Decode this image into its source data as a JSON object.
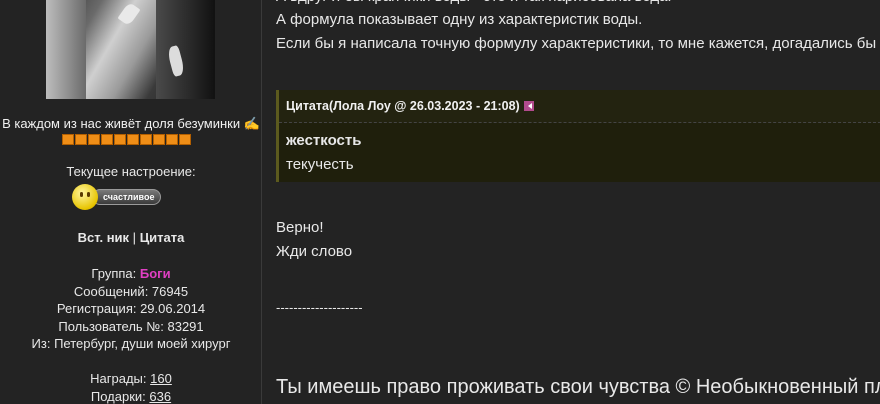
{
  "sidebar": {
    "motto": "В каждом из нас живёт доля безуминки ✍",
    "rank_bar": {
      "filled": 10,
      "total": 10,
      "color": "#ef8e17"
    },
    "mood_label": "Текущее настроение:",
    "mood_value": "счастливое",
    "insert_nick": "Вст. ник",
    "separator": "|",
    "quote": "Цитата",
    "group_label": "Группа:",
    "group_value": "Боги",
    "group_color": "#e03fc3",
    "messages": "Сообщений: 76945",
    "registration": "Регистрация: 29.06.2014",
    "user_number": "Пользователь №: 83291",
    "location": "Из: Петербург, души моей хирург",
    "awards_label": "Награды:",
    "awards_value": "160",
    "gifts_label": "Подарки:",
    "gifts_value": "636"
  },
  "post": {
    "cut_line": "А вдруг я бы кранчики воды - это и так нарисована вода.",
    "line1": "А формула показывает одну из характеристик воды.",
    "line2": "Если бы я написала точную формулу характеристики, то мне кажется, догадались бы",
    "quote_header": "Цитата(Лола Лоу @ 26.03.2023 - 21:08)",
    "quote_line1": "жесткость",
    "quote_line2": "текучесть",
    "reply1": "Верно!",
    "reply2": "Жди слово",
    "divider": "--------------------",
    "signature": "Ты имеешь право проживать свои чувства © Необыкновенный пл"
  }
}
